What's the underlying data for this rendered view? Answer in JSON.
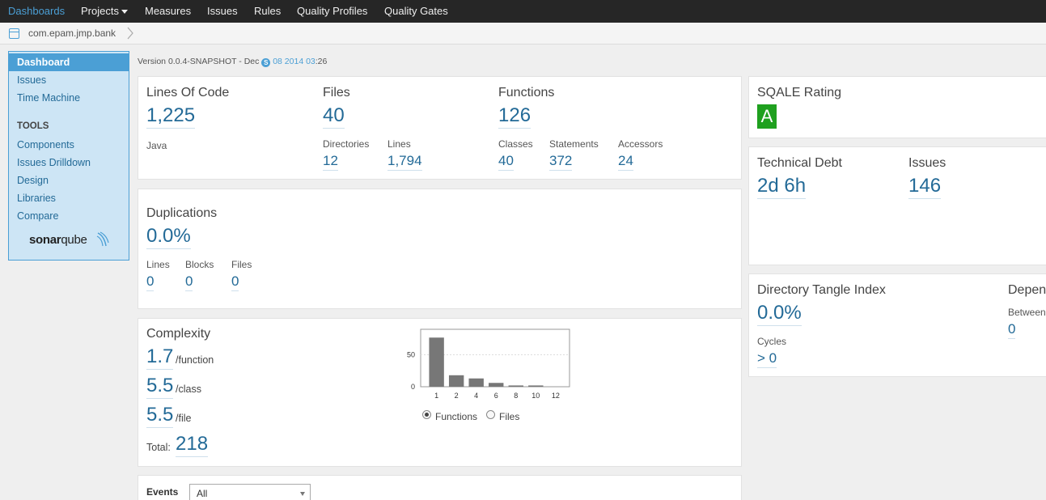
{
  "nav": {
    "items": [
      {
        "label": "Dashboards"
      },
      {
        "label": "Projects"
      },
      {
        "label": "Measures"
      },
      {
        "label": "Issues"
      },
      {
        "label": "Rules"
      },
      {
        "label": "Quality Profiles"
      },
      {
        "label": "Quality Gates"
      }
    ]
  },
  "breadcrumb": {
    "project": "com.epam.jmp.bank"
  },
  "sidebar": {
    "items": [
      {
        "label": "Dashboard"
      },
      {
        "label": "Issues"
      },
      {
        "label": "Time Machine"
      }
    ],
    "tools_heading": "TOOLS",
    "tools": [
      {
        "label": "Components"
      },
      {
        "label": "Issues Drilldown"
      },
      {
        "label": "Design"
      },
      {
        "label": "Libraries"
      },
      {
        "label": "Compare"
      }
    ],
    "logo": {
      "part1": "sonar",
      "part2": "qube"
    }
  },
  "version": {
    "prefix": "Version 0.0.4-SNAPSHOT - Dec",
    "bubble": "S",
    "date": " 08 2014 03",
    "suffix": ":26"
  },
  "size": {
    "loc_title": "Lines Of Code",
    "loc_value": "1,225",
    "language": "Java",
    "files_title": "Files",
    "files_value": "40",
    "dirs_label": "Directories",
    "dirs_value": "12",
    "lines_label": "Lines",
    "lines_value": "1,794",
    "functions_title": "Functions",
    "functions_value": "126",
    "classes_label": "Classes",
    "classes_value": "40",
    "statements_label": "Statements",
    "statements_value": "372",
    "accessors_label": "Accessors",
    "accessors_value": "24"
  },
  "duplications": {
    "title": "Duplications",
    "value": "0.0%",
    "lines_label": "Lines",
    "lines_value": "0",
    "blocks_label": "Blocks",
    "blocks_value": "0",
    "files_label": "Files",
    "files_value": "0"
  },
  "complexity": {
    "title": "Complexity",
    "per_function_value": "1.7",
    "per_function_unit": "/function",
    "per_class_value": "5.5",
    "per_class_unit": "/class",
    "per_file_value": "5.5",
    "per_file_unit": "/file",
    "total_label": "Total:",
    "total_value": "218",
    "radio_functions": "Functions",
    "radio_files": "Files"
  },
  "chart_data": {
    "type": "bar",
    "categories": [
      "1",
      "2",
      "4",
      "6",
      "8",
      "10",
      "12"
    ],
    "values": [
      77,
      18,
      13,
      6,
      2,
      2,
      0
    ],
    "ylim": [
      0,
      90
    ],
    "y_ticks": [
      "0",
      "50"
    ],
    "grid": true,
    "colors": {
      "bar": "#777777"
    }
  },
  "sqale": {
    "title": "SQALE Rating",
    "rating": "A",
    "color": "#1fa01f"
  },
  "debt": {
    "title": "Technical Debt",
    "value": "2d 6h",
    "issues_title": "Issues",
    "issues_value": "146"
  },
  "tangle": {
    "title": "Directory Tangle Index",
    "value": "0.0%",
    "cycles_label": "Cycles",
    "cycles_value": "> 0",
    "deps_title": "Depend",
    "between_label": "Between",
    "between_value": "0"
  },
  "events": {
    "title": "Events",
    "selected": "All"
  },
  "colors": {
    "accent": "#4b9fd5",
    "link": "#236a97",
    "nav_bg": "#262626"
  }
}
